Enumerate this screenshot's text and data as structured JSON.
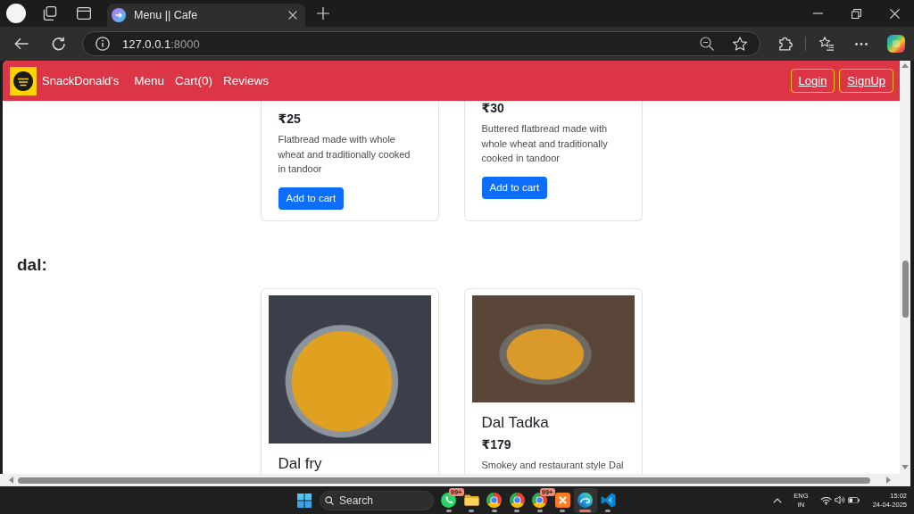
{
  "browser": {
    "tabs": [
      {
        "title": "Menu || Cafe",
        "selected": true
      }
    ],
    "address": {
      "host": "127.0.0.1",
      "port": ":8000"
    }
  },
  "navbar": {
    "brand": "SnackDonald's",
    "links": [
      {
        "label": "Menu"
      },
      {
        "label": "Cart(0)"
      },
      {
        "label": "Reviews"
      }
    ],
    "buttons": [
      {
        "label": "Login"
      },
      {
        "label": "SignUp"
      }
    ]
  },
  "sections": [
    {
      "items": [
        {
          "kind": "text",
          "price": "₹25",
          "description": "Flatbread made with whole wheat and traditionally cooked in tandoor",
          "button": "Add to cart"
        },
        {
          "kind": "text",
          "price": "₹30",
          "description": "Buttered flatbread made with whole wheat and traditionally cooked in tandoor",
          "button": "Add to cart"
        }
      ]
    },
    {
      "heading": "dal:",
      "items": [
        {
          "kind": "photo",
          "title": "Dal fry"
        },
        {
          "kind": "photo",
          "title": "Dal Tadka",
          "price": "₹179",
          "description": "Smokey and restaurant style Dal"
        }
      ]
    }
  ],
  "taskbar": {
    "search": {
      "placeholder": "Search"
    },
    "apps": [
      {
        "kind": "chat",
        "badge": "99+",
        "selected": false
      },
      {
        "kind": "folder",
        "selected": false
      },
      {
        "kind": "ring",
        "selected": false
      },
      {
        "kind": "ring",
        "selected": false
      },
      {
        "kind": "ring",
        "badge": "99+",
        "selected": false
      },
      {
        "kind": "tile",
        "selected": false
      },
      {
        "kind": "swirl",
        "selected": true
      },
      {
        "kind": "ribbon",
        "selected": false
      }
    ],
    "tray": {
      "language": "ENG",
      "region": "IN",
      "time": "15:02",
      "date": "24-04-2025"
    }
  }
}
